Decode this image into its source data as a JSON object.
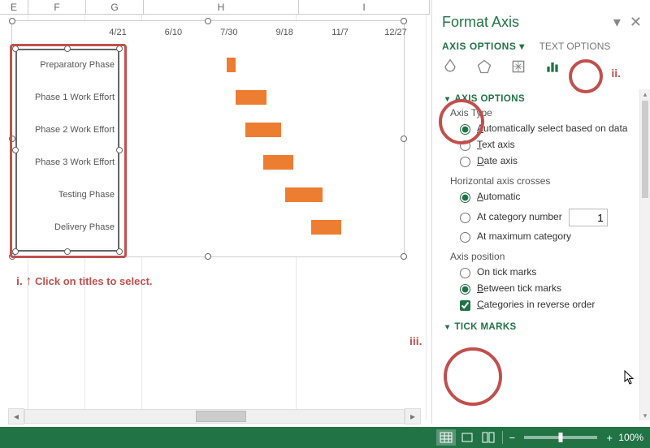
{
  "columns": [
    "E",
    "F",
    "G",
    "H",
    "I"
  ],
  "chart_data": {
    "type": "gantt",
    "x_ticks": [
      "4/21",
      "6/10",
      "7/30",
      "9/18",
      "11/7",
      "12/27"
    ],
    "categories": [
      "Preparatory Phase",
      "Phase 1 Work Effort",
      "Phase 2 Work Effort",
      "Phase 3 Work Effort",
      "Testing Phase",
      "Delivery Phase"
    ],
    "tasks": [
      {
        "start_pct": 39.5,
        "dur_pct": 3.5
      },
      {
        "start_pct": 43.0,
        "dur_pct": 11.0
      },
      {
        "start_pct": 46.5,
        "dur_pct": 13.0
      },
      {
        "start_pct": 53.0,
        "dur_pct": 11.0
      },
      {
        "start_pct": 61.0,
        "dur_pct": 13.5
      },
      {
        "start_pct": 70.5,
        "dur_pct": 11.0
      }
    ],
    "title": "",
    "xlabel": "",
    "ylabel": "",
    "xlim": [
      "4/21",
      "12/27"
    ]
  },
  "annotation": {
    "i": "i.",
    "ii": "ii.",
    "iii": "iii.",
    "click_titles": "Click on titles to select."
  },
  "pane": {
    "title": "Format Axis",
    "tabs": {
      "options": "AXIS OPTIONS",
      "options_arrow": "▾",
      "text": "TEXT OPTIONS"
    },
    "sections": {
      "axis_options": "AXIS OPTIONS",
      "axis_type": "Axis Type",
      "type_auto_a": "A",
      "type_auto_rest": "utomatically select based on data",
      "type_text_t": "T",
      "type_text_rest": "ext axis",
      "type_date_d": "D",
      "type_date_rest": "ate axis",
      "crosses": "Horizontal axis crosses",
      "cross_auto_a": "A",
      "cross_auto_rest": "utomatic",
      "cross_cat": "At category number",
      "cross_cat_val": "1",
      "cross_max": "At maximum category",
      "position": "Axis position",
      "pos_on": "On tick marks",
      "pos_between_b": "B",
      "pos_between_rest": "etween tick marks",
      "reverse_c": "C",
      "reverse_rest": "ategories in reverse order",
      "tick_marks": "TICK MARKS"
    }
  },
  "status": {
    "zoom": "100%"
  }
}
